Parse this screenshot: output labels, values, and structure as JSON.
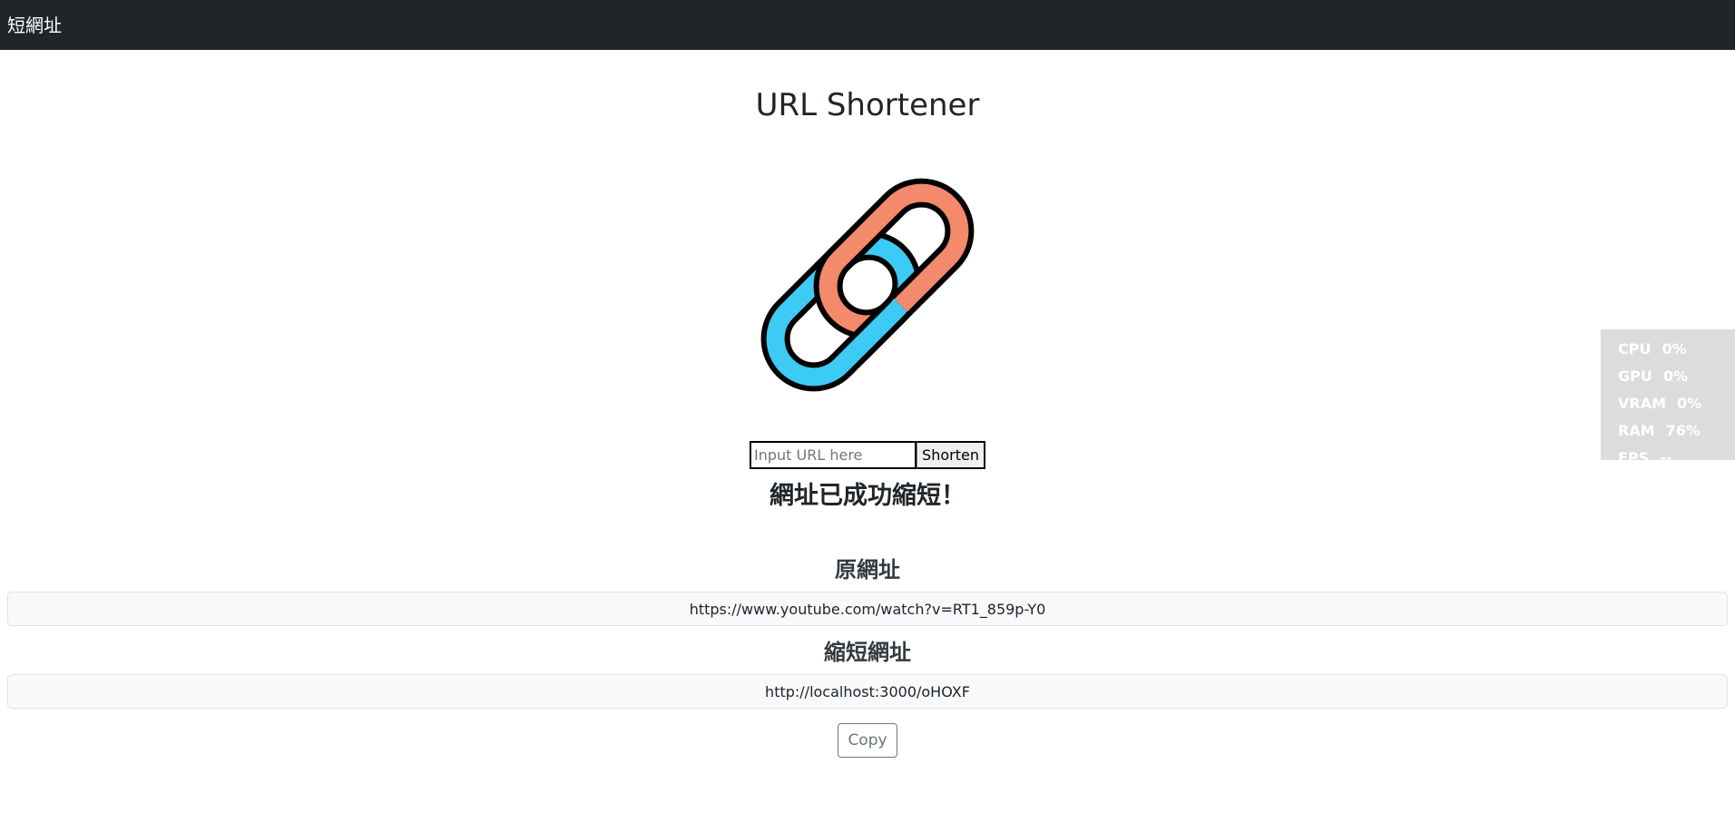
{
  "navbar": {
    "brand": "短網址"
  },
  "main": {
    "title": "URL Shortener",
    "logo_icon": "chain-link-icon",
    "colors": {
      "link_orange": "#f4896b",
      "link_blue": "#3ccbf4",
      "outline": "#000000"
    },
    "form": {
      "input_placeholder": "Input URL here",
      "input_value": "",
      "button_label": "Shorten"
    },
    "success_message": "網址已成功縮短！",
    "original": {
      "label": "原網址",
      "value": "https://www.youtube.com/watch?v=RT1_859p-Y0"
    },
    "shortened": {
      "label": "縮短網址",
      "value": "http://localhost:3000/oHOXF"
    },
    "copy_button_label": "Copy"
  },
  "perf_overlay": {
    "rows": [
      {
        "label": "CPU",
        "value": "0%"
      },
      {
        "label": "GPU",
        "value": "0%"
      },
      {
        "label": "VRAM",
        "value": "0%"
      },
      {
        "label": "RAM",
        "value": "76%"
      },
      {
        "label": "FPS",
        "value": "--"
      }
    ]
  }
}
